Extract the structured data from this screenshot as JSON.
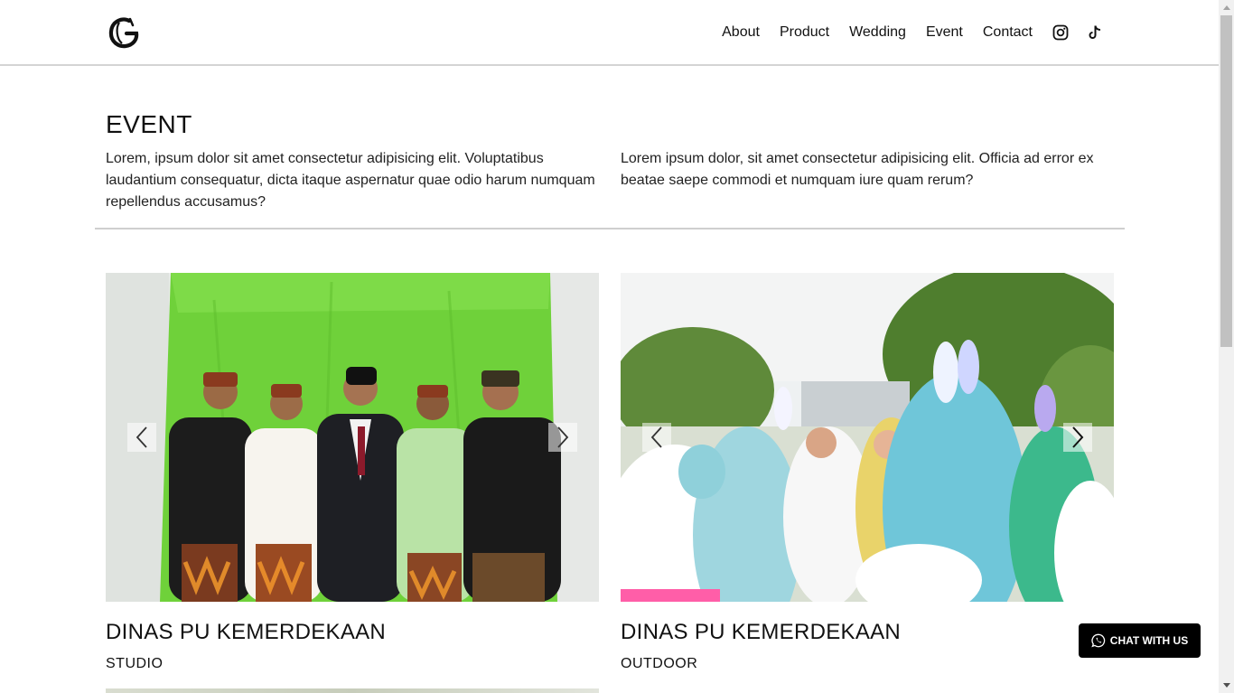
{
  "header": {
    "logo": "G",
    "nav": [
      "About",
      "Product",
      "Wedding",
      "Event",
      "Contact"
    ],
    "social": [
      "instagram-icon",
      "tiktok-icon"
    ]
  },
  "intro": {
    "title": "EVENT",
    "left_text": "Lorem, ipsum dolor sit amet consectetur adipisicing elit. Voluptatibus laudantium consequatur, dicta itaque aspernatur quae odio harum numquam repellendus accusamus?",
    "right_text": "Lorem ipsum dolor, sit amet consectetur adipisicing elit. Officia ad error ex beataе saepe commodi et numquam iure quam rerum?"
  },
  "cards": [
    {
      "title": "DINAS PU KEMERDEKAAN",
      "subtitle": "STUDIO"
    },
    {
      "title": "DINAS PU KEMERDEKAAN",
      "subtitle": "OUTDOOR"
    }
  ],
  "chat": {
    "label": "CHAT WITH US",
    "icon": "whatsapp-icon"
  },
  "colors": {
    "accent": "#000000",
    "divider": "#cfcfcf",
    "greenscreen": "#6fd13a"
  }
}
